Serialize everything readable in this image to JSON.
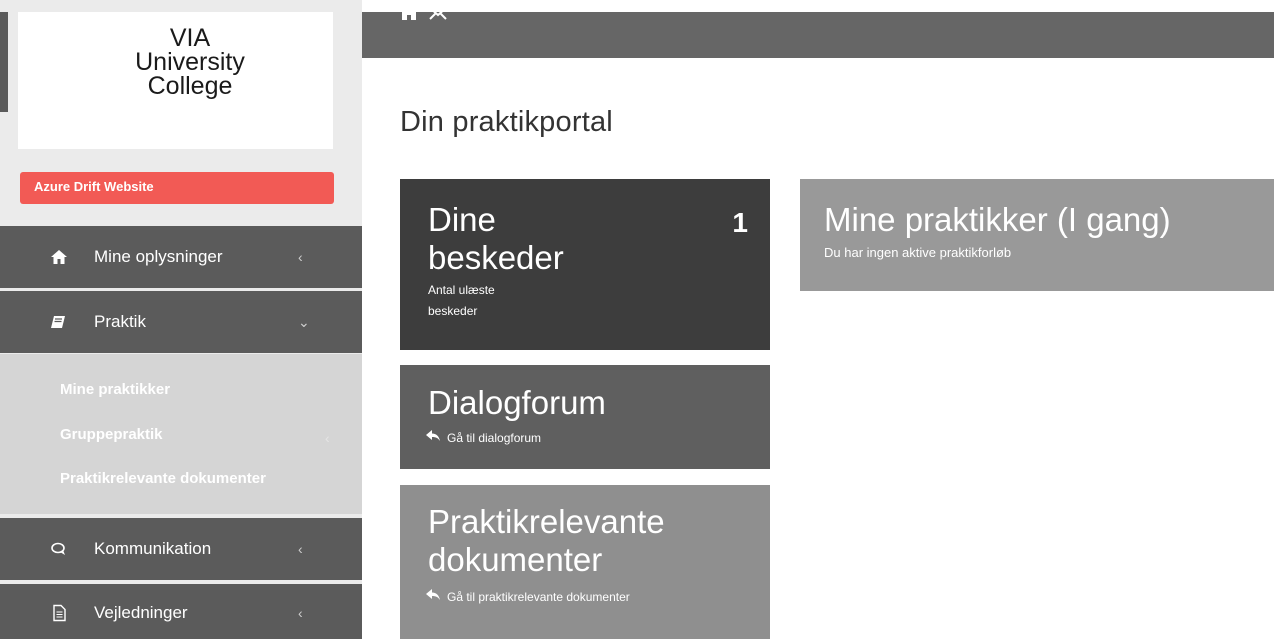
{
  "sidebar": {
    "logo": {
      "line1": "VIA",
      "line2": "University",
      "line3": "College"
    },
    "environment_badge": "Azure Drift Website",
    "nav": {
      "mine_oplysninger": {
        "label": "Mine oplysninger",
        "icon": "home-icon"
      },
      "praktik": {
        "label": "Praktik",
        "icon": "book-icon"
      },
      "kommunikation": {
        "label": "Kommunikation",
        "icon": "chat-icon"
      },
      "vejledninger": {
        "label": "Vejledninger",
        "icon": "document-icon"
      }
    },
    "praktik_sub": {
      "mine_praktikker": "Mine praktikker",
      "gruppepraktik": "Gruppepraktik",
      "praktikrelevante_dokumenter": "Praktikrelevante dokumenter"
    }
  },
  "topbar": {
    "icons": [
      "home-icon",
      "mail-icon"
    ]
  },
  "main": {
    "title": "Din praktikportal",
    "tiles": {
      "beskeder": {
        "title_line1": "Dine",
        "title_line2": "beskeder",
        "count": "1",
        "sub_line1": "Antal ulæste",
        "sub_line2": "beskeder"
      },
      "dialogforum": {
        "title": "Dialogforum",
        "link": "Gå til dialogforum"
      },
      "dokumenter": {
        "title_line1": "Praktikrelevante",
        "title_line2": "dokumenter",
        "link": "Gå til praktikrelevante dokumenter"
      },
      "praktikker": {
        "title": "Mine praktikker (I gang)",
        "subtitle": "Du har ingen aktive praktikforløb"
      }
    }
  },
  "colors": {
    "badge": "#f25a55",
    "nav_bg": "#5b5b5b",
    "tile_dark": "#3d3d3d",
    "tile_mid": "#5f5f5f",
    "tile_light": "#8f8f8f",
    "tile_right": "#999999"
  }
}
